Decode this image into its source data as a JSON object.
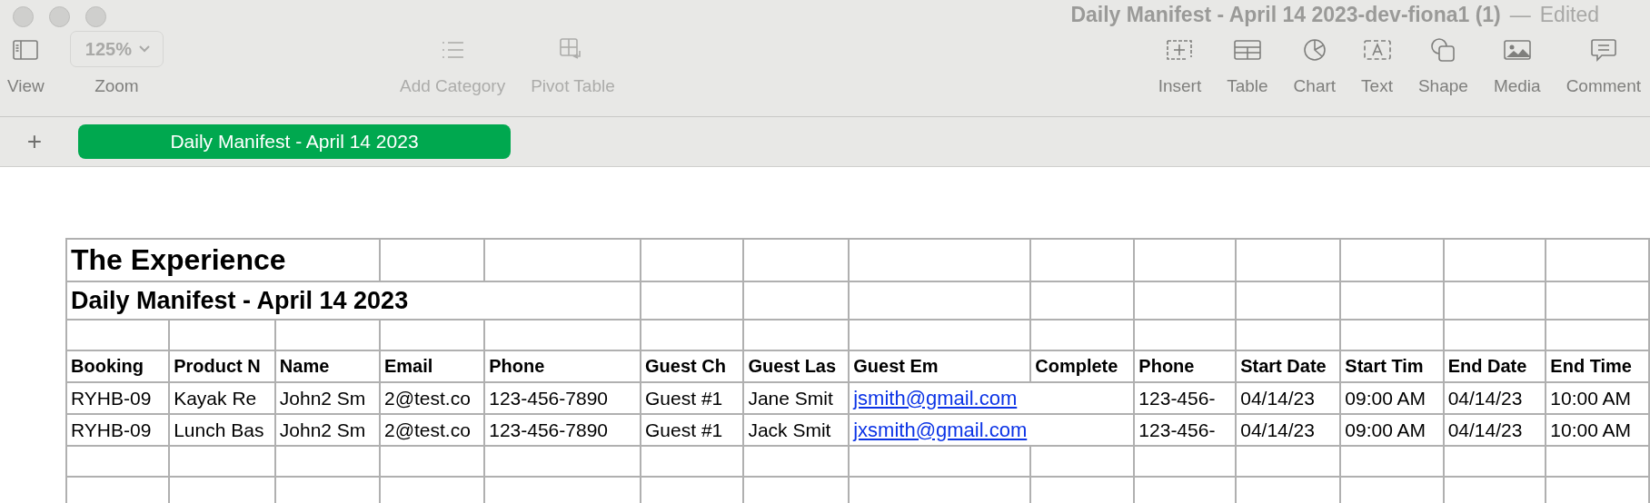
{
  "window": {
    "title": "Daily Manifest - April 14 2023-dev-fiona1 (1)",
    "separator": "—",
    "status": "Edited"
  },
  "toolbar": [
    {
      "kind": "view",
      "label": "View",
      "disabled": false
    },
    {
      "kind": "zoom",
      "label": "Zoom",
      "value": "125%",
      "disabled": false
    },
    {
      "kind": "add-category",
      "label": "Add Category",
      "disabled": true
    },
    {
      "kind": "pivot",
      "label": "Pivot Table",
      "disabled": true
    },
    {
      "kind": "insert",
      "label": "Insert",
      "disabled": false
    },
    {
      "kind": "table",
      "label": "Table",
      "disabled": false
    },
    {
      "kind": "chart",
      "label": "Chart",
      "disabled": false
    },
    {
      "kind": "text",
      "label": "Text",
      "disabled": false
    },
    {
      "kind": "shape",
      "label": "Shape",
      "disabled": false
    },
    {
      "kind": "media",
      "label": "Media",
      "disabled": false
    },
    {
      "kind": "comment",
      "label": "Comment",
      "disabled": false
    }
  ],
  "sheet_tabs": {
    "add": "+",
    "tabs": [
      {
        "label": "Daily Manifest - April 14 2023",
        "selected": true
      }
    ]
  },
  "table": {
    "title": "The Experience",
    "subtitle": "Daily Manifest - April 14 2023",
    "columns": [
      "Booking",
      "Product N",
      "Name",
      "Email",
      "Phone",
      "Guest Ch",
      "Guest Las",
      "Guest Em",
      "Complete",
      "Phone",
      "Start Date",
      "Start Tim",
      "End Date",
      "End Time"
    ],
    "rows": [
      {
        "cells": [
          {
            "text": "RYHB-09",
            "kind": "text"
          },
          {
            "text": "Kayak Re",
            "kind": "text"
          },
          {
            "text": "John2 Sm",
            "kind": "text"
          },
          {
            "text": "2@test.co",
            "kind": "text"
          },
          {
            "text": "123-456-7890",
            "kind": "text"
          },
          {
            "text": "Guest #1",
            "kind": "text"
          },
          {
            "text": "Jane Smit",
            "kind": "text"
          },
          {
            "text": "jsmith@gmail.com",
            "kind": "link"
          },
          {
            "text": "",
            "kind": "text"
          },
          {
            "text": "123-456-",
            "kind": "text"
          },
          {
            "text": "04/14/23",
            "kind": "text"
          },
          {
            "text": "09:00 AM",
            "kind": "text"
          },
          {
            "text": "04/14/23",
            "kind": "text"
          },
          {
            "text": "10:00 AM",
            "kind": "text"
          }
        ]
      },
      {
        "cells": [
          {
            "text": "RYHB-09",
            "kind": "text"
          },
          {
            "text": "Lunch Bas",
            "kind": "text"
          },
          {
            "text": "John2 Sm",
            "kind": "text"
          },
          {
            "text": "2@test.co",
            "kind": "text"
          },
          {
            "text": "123-456-7890",
            "kind": "text"
          },
          {
            "text": "Guest #1",
            "kind": "text"
          },
          {
            "text": "Jack Smit",
            "kind": "text"
          },
          {
            "text": "jxsmith@gmail.com",
            "kind": "link"
          },
          {
            "text": "",
            "kind": "text"
          },
          {
            "text": "123-456-",
            "kind": "text"
          },
          {
            "text": "04/14/23",
            "kind": "text"
          },
          {
            "text": "09:00 AM",
            "kind": "text"
          },
          {
            "text": "04/14/23",
            "kind": "text"
          },
          {
            "text": "10:00 AM",
            "kind": "text"
          }
        ]
      }
    ]
  }
}
